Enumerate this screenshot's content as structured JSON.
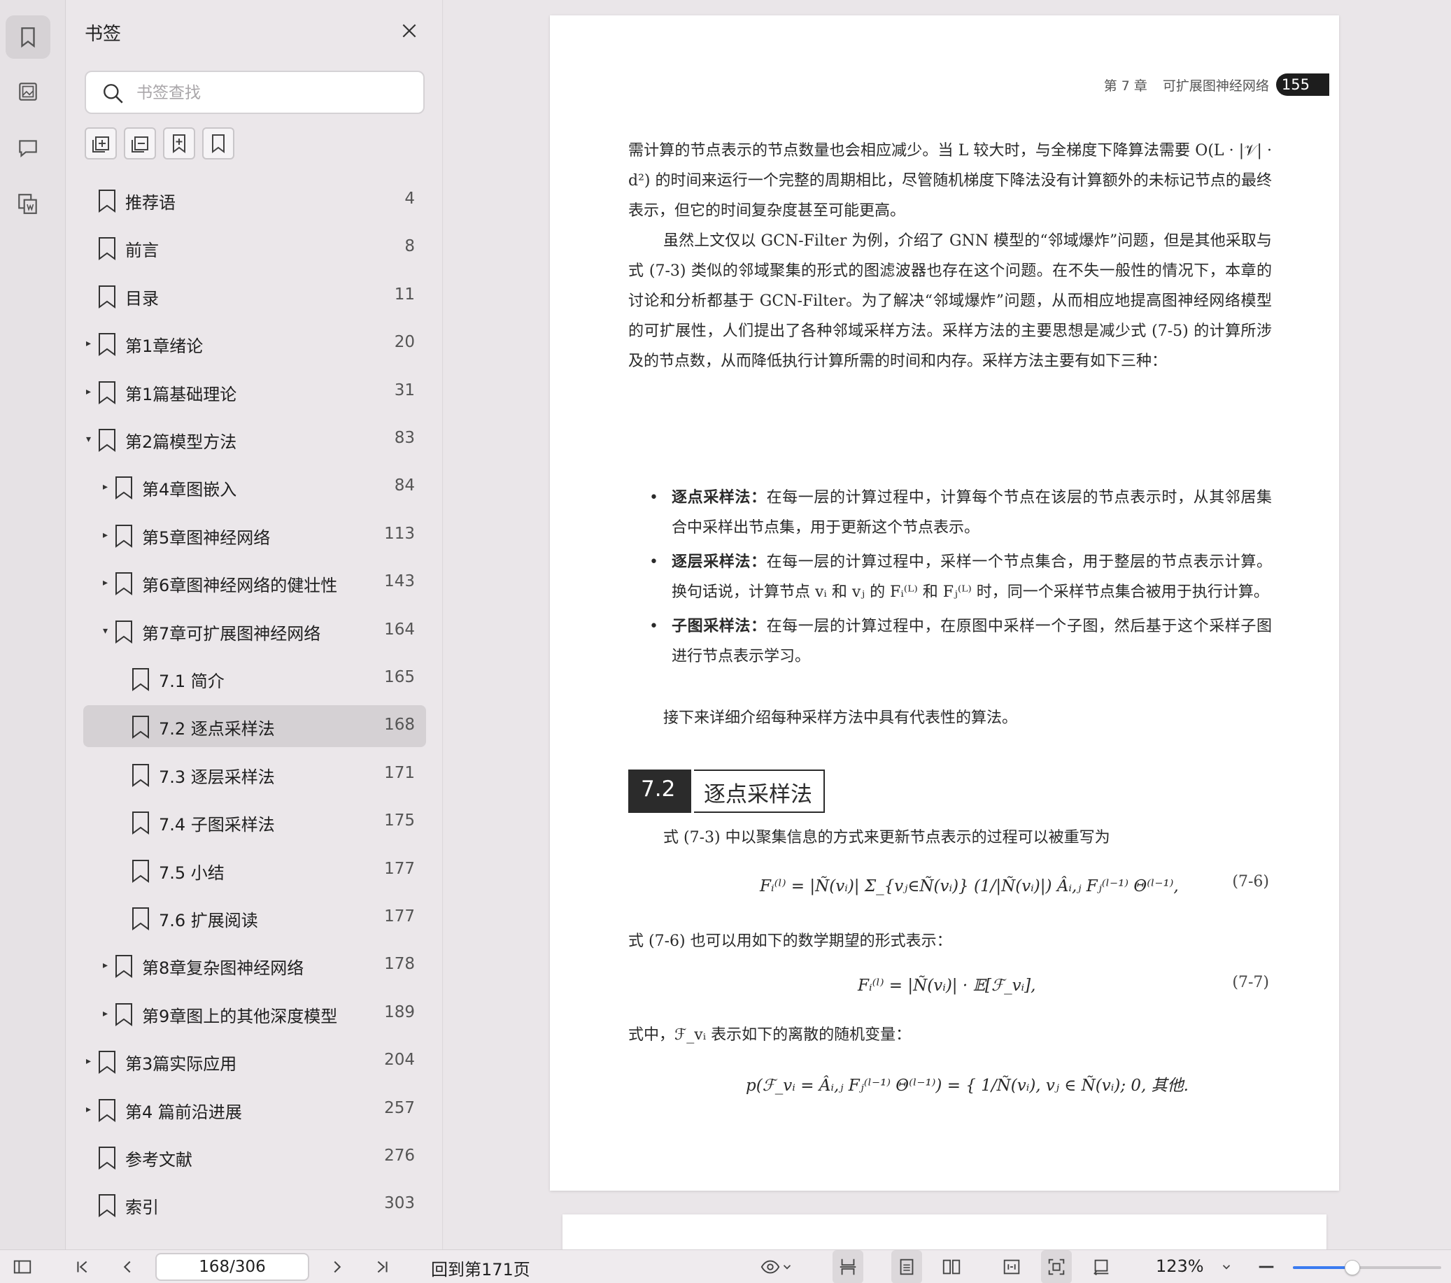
{
  "panel": {
    "title": "书签",
    "search_placeholder": "书签查找"
  },
  "bookmarks": [
    {
      "label": "推荐语",
      "page": "4",
      "level": 0,
      "arrow": ""
    },
    {
      "label": "前言",
      "page": "8",
      "level": 0,
      "arrow": ""
    },
    {
      "label": "目录",
      "page": "11",
      "level": 0,
      "arrow": ""
    },
    {
      "label": "第1章绪论",
      "page": "20",
      "level": 0,
      "arrow": "▸"
    },
    {
      "label": "第1篇基础理论",
      "page": "31",
      "level": 0,
      "arrow": "▸"
    },
    {
      "label": "第2篇模型方法",
      "page": "83",
      "level": 0,
      "arrow": "▾"
    },
    {
      "label": "第4章图嵌入",
      "page": "84",
      "level": 1,
      "arrow": "▸"
    },
    {
      "label": "第5章图神经网络",
      "page": "113",
      "level": 1,
      "arrow": "▸"
    },
    {
      "label": "第6章图神经网络的健壮性",
      "page": "143",
      "level": 1,
      "arrow": "▸"
    },
    {
      "label": "第7章可扩展图神经网络",
      "page": "164",
      "level": 1,
      "arrow": "▾"
    },
    {
      "label": "7.1 简介",
      "page": "165",
      "level": 2,
      "arrow": ""
    },
    {
      "label": "7.2 逐点采样法",
      "page": "168",
      "level": 2,
      "arrow": "",
      "selected": true
    },
    {
      "label": "7.3 逐层采样法",
      "page": "171",
      "level": 2,
      "arrow": ""
    },
    {
      "label": "7.4 子图采样法",
      "page": "175",
      "level": 2,
      "arrow": ""
    },
    {
      "label": "7.5 小结",
      "page": "177",
      "level": 2,
      "arrow": ""
    },
    {
      "label": "7.6 扩展阅读",
      "page": "177",
      "level": 2,
      "arrow": ""
    },
    {
      "label": "第8章复杂图神经网络",
      "page": "178",
      "level": 1,
      "arrow": "▸"
    },
    {
      "label": "第9章图上的其他深度模型",
      "page": "189",
      "level": 1,
      "arrow": "▸"
    },
    {
      "label": "第3篇实际应用",
      "page": "204",
      "level": 0,
      "arrow": "▸"
    },
    {
      "label": "第4 篇前沿进展",
      "page": "257",
      "level": 0,
      "arrow": "▸"
    },
    {
      "label": "参考文献",
      "page": "276",
      "level": 0,
      "arrow": ""
    },
    {
      "label": "索引",
      "page": "303",
      "level": 0,
      "arrow": ""
    }
  ],
  "document": {
    "running_head_chapter": "第 7 章",
    "running_head_title": "可扩展图神经网络",
    "page_number": "155",
    "para1": "需计算的节点表示的节点数量也会相应减少。当 L 较大时，与全梯度下降算法需要 O(L · |𝒱| · d²) 的时间来运行一个完整的周期相比，尽管随机梯度下降法没有计算额外的未标记节点的最终表示，但它的时间复杂度甚至可能更高。",
    "para2": "虽然上文仅以 GCN-Filter 为例，介绍了 GNN 模型的“邻域爆炸”问题，但是其他采取与式 (7-3) 类似的邻域聚集的形式的图滤波器也存在这个问题。在不失一般性的情况下，本章的讨论和分析都基于 GCN-Filter。为了解决“邻域爆炸”问题，从而相应地提高图神经网络模型的可扩展性，人们提出了各种邻域采样方法。采样方法的主要思想是减少式 (7-5) 的计算所涉及的节点数，从而降低执行计算所需的时间和内存。采样方法主要有如下三种：",
    "bullet1_head": "逐点采样法：",
    "bullet1_body": "在每一层的计算过程中，计算每个节点在该层的节点表示时，从其邻居集合中采样出节点集，用于更新这个节点表示。",
    "bullet2_head": "逐层采样法：",
    "bullet2_body": "在每一层的计算过程中，采样一个节点集合，用于整层的节点表示计算。换句话说，计算节点 vᵢ 和 vⱼ 的 Fᵢ⁽ᴸ⁾ 和 Fⱼ⁽ᴸ⁾ 时，同一个采样节点集合被用于执行计算。",
    "bullet3_head": "子图采样法：",
    "bullet3_body": "在每一层的计算过程中，在原图中采样一个子图，然后基于这个采样子图进行节点表示学习。",
    "para3": "接下来详细介绍每种采样方法中具有代表性的算法。",
    "section_number": "7.2",
    "section_title": "逐点采样法",
    "para4": "式 (7-3) 中以聚集信息的方式来更新节点表示的过程可以被重写为",
    "eq1": "Fᵢ⁽ˡ⁾ = |Ñ(vᵢ)| Σ_{vⱼ∈Ñ(vᵢ)} (1/|Ñ(vᵢ)|) Âᵢ,ⱼ Fⱼ⁽ˡ⁻¹⁾ Θ⁽ˡ⁻¹⁾,",
    "eq1_no": "(7-6)",
    "para5": "式 (7-6) 也可以用如下的数学期望的形式表示：",
    "eq2": "Fᵢ⁽ˡ⁾ = |Ñ(vᵢ)| · 𝔼[ℱ_vᵢ],",
    "eq2_no": "(7-7)",
    "para6": "式中，ℱ_vᵢ 表示如下的离散的随机变量：",
    "eq3": "p(ℱ_vᵢ = Âᵢ,ⱼ Fⱼ⁽ˡ⁻¹⁾ Θ⁽ˡ⁻¹⁾) = { 1/Ñ(vᵢ), vⱼ ∈ Ñ(vᵢ);  0, 其他."
  },
  "toolbar": {
    "page_indicator": "168/306",
    "goto_label": "回到第171页",
    "zoom_label": "123%",
    "zoom_level": 0.4
  },
  "colors": {
    "accent": "#3a7bf0",
    "selected_row": "#d5d1d4",
    "panel_bg": "#ebe7ea"
  }
}
